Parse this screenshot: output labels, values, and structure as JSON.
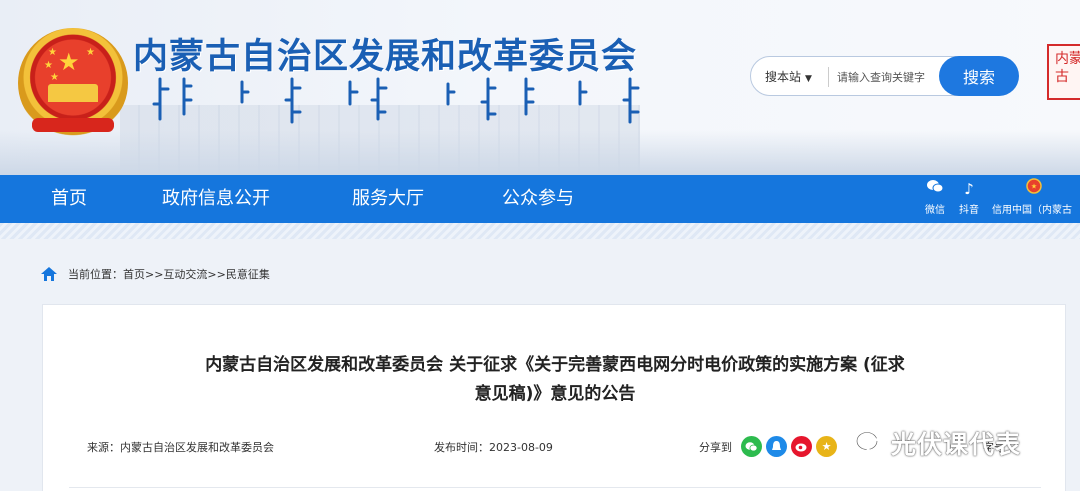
{
  "header": {
    "site_title": "内蒙古自治区发展和改革委员会",
    "search": {
      "scope_label": "搜本站",
      "placeholder": "请输入查询关键字",
      "button_label": "搜索"
    },
    "seal_text": "内蒙古"
  },
  "nav": {
    "items": [
      "首页",
      "政府信息公开",
      "服务大厅",
      "公众参与"
    ],
    "social": [
      {
        "label": "微信",
        "icon": "wechat-icon"
      },
      {
        "label": "抖音",
        "icon": "douyin-icon"
      },
      {
        "label": "信用中国（内蒙古",
        "icon": "emblem-icon"
      }
    ]
  },
  "breadcrumb": {
    "text": "当前位置：首页>>互动交流>>民意征集"
  },
  "article": {
    "title_line1": "内蒙古自治区发展和改革委员会 关于征求《关于完善蒙西电网分时电价政策的实施方案 (征求",
    "title_line2": "意见稿)》意见的公告",
    "source": "来源：内蒙古自治区发展和改革委员会",
    "publish_time": "发布时间：2023-08-09",
    "share_label": "分享到",
    "font_size_label": "字号"
  },
  "watermark": "光伏课代表",
  "colors": {
    "brand_blue": "#1576dd",
    "title_blue": "#1a5fb4",
    "wechat_green": "#2dbb4e",
    "qq_blue": "#1e8ae8",
    "weibo_red": "#e6162d",
    "favorite_gold": "#e8b418"
  }
}
